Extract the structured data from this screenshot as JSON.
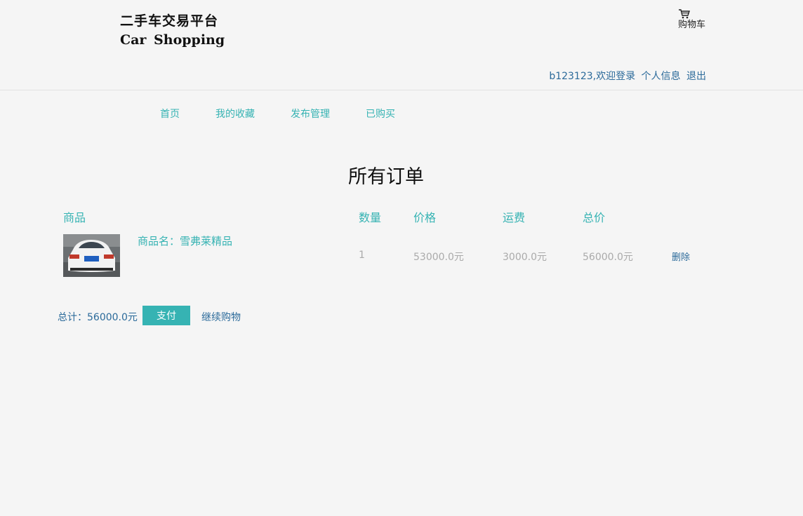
{
  "header": {
    "logo_cn": "二手车交易平台",
    "logo_en": "Car Shopping",
    "cart_label": "购物车",
    "cart_icon": "shopping-cart-icon",
    "welcome": "b123123,欢迎登录",
    "profile_link": "个人信息",
    "logout_link": "退出"
  },
  "nav": {
    "items": [
      {
        "label": "首页"
      },
      {
        "label": "我的收藏"
      },
      {
        "label": "发布管理"
      },
      {
        "label": "已购买"
      }
    ]
  },
  "page": {
    "title": "所有订单"
  },
  "order_table": {
    "headers": {
      "product": "商品",
      "quantity": "数量",
      "price": "价格",
      "shipping": "运费",
      "total": "总价"
    },
    "rows": [
      {
        "product_name": "商品名：雪弗莱精品",
        "quantity": "1",
        "price": "53000.0元",
        "shipping": "3000.0元",
        "total": "56000.0元",
        "delete_label": "删除"
      }
    ]
  },
  "footer": {
    "total_label": "总计：56000.0元",
    "pay_label": "支付",
    "continue_label": "继续购物"
  },
  "colors": {
    "accent": "#36b3b3",
    "link": "#2b6a9a",
    "background": "#f5f5f5"
  }
}
